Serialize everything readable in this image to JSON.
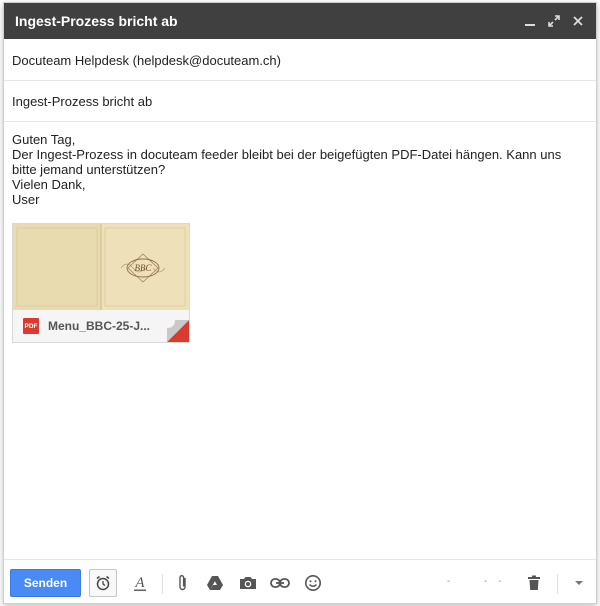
{
  "window": {
    "title": "Ingest-Prozess bricht ab"
  },
  "compose": {
    "to": "Docuteam Helpdesk (helpdesk@docuteam.ch)",
    "subject": "Ingest-Prozess bricht ab",
    "body_lines": [
      "Guten Tag,",
      "Der Ingest-Prozess in docuteam feeder bleibt bei der beigefügten PDF-Datei hängen. Kann uns bitte jemand unterstützen?",
      "Vielen Dank,",
      "User"
    ]
  },
  "attachment": {
    "type_badge": "PDF",
    "filename": "Menu_BBC-25-J...",
    "thumb_text": "BBC"
  },
  "toolbar": {
    "send_label": "Senden",
    "dots_left": "-",
    "dots_right": "- -"
  },
  "icons": {
    "minimize": "minimize-icon",
    "expand": "expand-icon",
    "close": "close-icon",
    "schedule": "alarm-clock-icon",
    "formatting": "text-format-icon",
    "attach": "paperclip-icon",
    "drive": "drive-icon",
    "photo": "camera-icon",
    "link": "link-icon",
    "emoji": "smiley-icon",
    "discard": "trash-icon",
    "more": "chevron-down-icon"
  },
  "colors": {
    "titlebar": "#404040",
    "send_button": "#4a8af4",
    "pdf_red": "#db3a2f"
  }
}
